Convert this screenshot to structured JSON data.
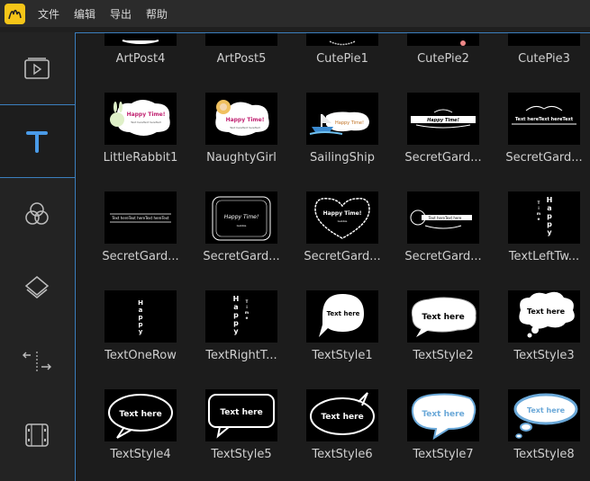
{
  "menu": {
    "file": "文件",
    "edit": "编辑",
    "export": "导出",
    "help": "帮助"
  },
  "sidebar": {
    "items": [
      {
        "name": "media",
        "icon": "media-play-icon"
      },
      {
        "name": "text",
        "icon": "text-t-icon",
        "active": true
      },
      {
        "name": "filters",
        "icon": "filters-circles-icon"
      },
      {
        "name": "overlays",
        "icon": "overlay-layers-icon"
      },
      {
        "name": "transitions",
        "icon": "transition-arrows-icon"
      },
      {
        "name": "elements",
        "icon": "film-element-icon"
      }
    ]
  },
  "colors": {
    "accent": "#4a9be8",
    "logo": "#f5c518"
  },
  "rows": [
    {
      "items": [
        "ArtPost4",
        "ArtPost5",
        "CutePie1",
        "CutePie2",
        "CutePie3"
      ]
    },
    {
      "items": [
        "LittleRabbit1",
        "NaughtyGirl",
        "SailingShip",
        "SecretGard...",
        "SecretGard..."
      ]
    },
    {
      "items": [
        "SecretGard...",
        "SecretGard...",
        "SecretGard...",
        "SecretGard...",
        "TextLeftTw..."
      ]
    },
    {
      "items": [
        "TextOneRow",
        "TextRightT...",
        "TextStyle1",
        "TextStyle2",
        "TextStyle3"
      ]
    },
    {
      "items": [
        "TextStyle4",
        "TextStyle5",
        "TextStyle6",
        "TextStyle7",
        "TextStyle8"
      ]
    }
  ],
  "thumb_text": {
    "happy_time": "Happy Time!",
    "text_here": "Text here",
    "text_here_repeat": "Text hereText hereText",
    "happy": "Happy",
    "time": "time",
    "gabble": "Gabble"
  }
}
